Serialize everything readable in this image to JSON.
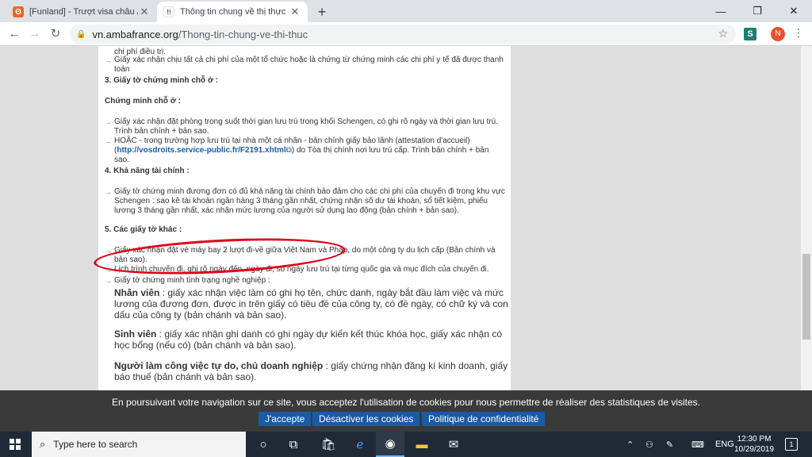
{
  "browser": {
    "tabs": [
      {
        "title": "[Funland] - Trượt visa châu Âu bu",
        "active": false
      },
      {
        "title": "Thông tin chung về thị thực ngắn",
        "active": true
      }
    ],
    "new_tab_label": "+",
    "window_controls": {
      "minimize": "—",
      "maximize": "❐",
      "close": "✕"
    },
    "url_host": "vn.ambafrance.org",
    "url_path": "/Thong-tin-chung-ve-thi-thuc",
    "profile_initial": "N",
    "extension_label": "S"
  },
  "page": {
    "top_items": [
      "Giấy chấp thuận tiếp nhận điều trị của một cơ sở y tế tại Pháp, ghi rõ ngày và thời gian nằm viện và được tính chi phí điều trị.",
      "Giấy xác nhận chịu tất cả chi phí của một tổ chức hoặc là chứng từ chứng minh các chi phí y tế đã được thanh toán"
    ],
    "section3_title": "3. Giấy tờ chứng minh chỗ ở :",
    "section3_subtitle": "Chứng minh chỗ ở :",
    "section3_item1": "Giấy xác nhận đặt phòng trong suốt thời gian lưu trú trong khối Schengen, có ghi rõ ngày và thời gian lưu trú. Trình bản chính + bản sao.",
    "section3_item2_a": "HOẶC - trong trường hợp lưu trú tại nhà một cá nhân - bản chính giấy bảo lãnh (attestation d'accueil)",
    "section3_item2_link": "http://vosdroits.service-public.fr/F2191.xhtml",
    "section3_item2_b": " do Tòa thị chính nơi lưu trú cấp. Trình bản chính + bản sao.",
    "section4_title": "4. Khả năng tài chính :",
    "section4_item": "Giấy tờ chứng minh đương đơn có đủ khả năng tài chính bảo đảm cho các chi phí của chuyến đi trong khu vực Schengen : sao kê tài khoản ngân hàng 3 tháng gần nhất, chứng nhận số dư tài khoản, sổ tiết kiệm, phiếu lương 3 tháng gần nhất, xác nhận mức lương của người sử dụng lao động (bản chính + bản sao).",
    "section5_title": "5. Các giấy tờ khác :",
    "section5_item1": "Giấy xác nhận đặt vé máy bay 2 lượt đi-về giữa Việt Nam và Pháp, do một công ty du lịch cấp (Bản chính và bản sao).",
    "section5_item2": "Lịch trình chuyến đi, ghi rõ ngày đến, ngày đi, số ngày lưu trú tại từng quốc gia và mục đích của chuyến đi.",
    "section5_item3": "Giấy tờ chứng minh tình trạng nghề nghiệp :",
    "employee_label": "Nhân viên",
    "employee_text": " : giấy xác nhận việc làm có ghi họ tên, chức danh, ngày bắt đầu làm việc và mức lương của đương đơn, được in trên giấy có tiêu đề của công ty, có đề ngày, có chữ ký và con dấu của công ty (bản chánh và bản sao).",
    "student_label": "Sinh viên",
    "student_text": " : giấy xác nhận ghi danh có ghi ngày dự kiến kết thúc khóa học, giấy xác nhận có học bổng (nếu có) (bản chánh và bản sao).",
    "freelance_label": "Người làm công việc tự do, chủ doanh nghiệp",
    "freelance_text": " : giấy chứng nhận đăng kí kinh doanh, giấy báo thuế (bản chánh và bản sao)."
  },
  "cookie_banner": {
    "text": "En poursuivant votre navigation sur ce site, vous acceptez l'utilisation de cookies pour nous permettre de réaliser des statistiques de visites.",
    "accept": "J'accepte",
    "disable": "Désactiver les cookies",
    "policy": "Politique de confidentialité"
  },
  "taskbar": {
    "search_placeholder": "Type here to search",
    "language": "ENG",
    "time": "12:30 PM",
    "date": "10/29/2019",
    "notification_count": "1"
  }
}
